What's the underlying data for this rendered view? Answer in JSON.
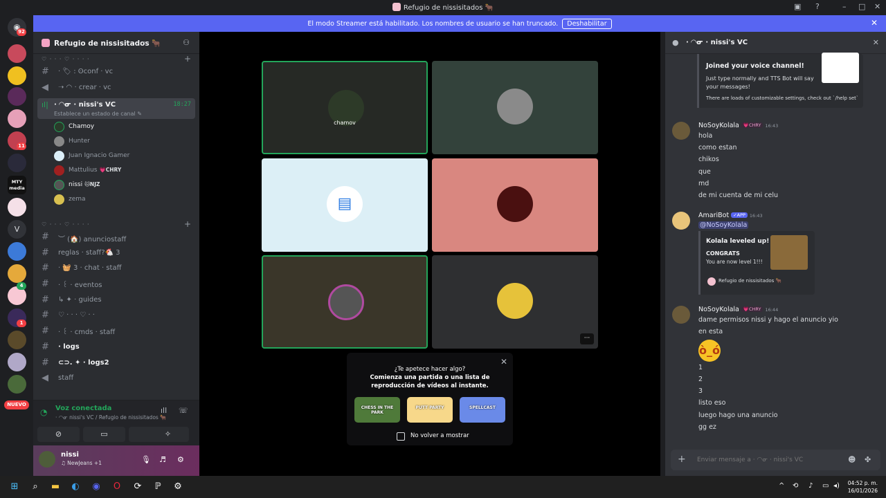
{
  "window": {
    "title": "Refugio de nissisitados 🐂"
  },
  "banner": {
    "text": "El modo Streamer está habilitado. Los nombres de usuario se han truncado.",
    "button": "Deshabilitar"
  },
  "guilds": {
    "badge_top": "92",
    "badge_a": "11",
    "badge_b": "4",
    "badge_c": "1",
    "nuevo": "NUEVO",
    "mty": "MTY media",
    "v": "V"
  },
  "server": {
    "name": "Refugio de nissisitados 🐂"
  },
  "categories": {
    "cat1": "♡ · · · ♡ · · · ·",
    "cat2": "♡ · · · ♡ · · · ·"
  },
  "channels": [
    {
      "label": "·  🏷  : ʘconf · vc"
    },
    {
      "label": "➝ ◠ · crear · vc"
    },
    {
      "label": "· ◠ᓂ · nissi's VC"
    },
    {
      "label": "︶ (🏠) anunciostaff"
    },
    {
      "label": "reglas · staff?🐔 3"
    },
    {
      "label": "· 🧺 3 · chat · staff"
    },
    {
      "label": "· ꒰ · eventos"
    },
    {
      "label": "↳ ✦ · guides"
    },
    {
      "label": "♡ · · · ♡ · ·"
    },
    {
      "label": "· ꒰ · cmds · staff"
    },
    {
      "label": "· logs"
    },
    {
      "label": "⊂⊃. ✦ · logs2"
    },
    {
      "label": "staff"
    }
  ],
  "voice_channel": {
    "name": "· ◠ᓂ · nissi's VC",
    "time": "18:27",
    "status": "Establece un estado de canal ✎"
  },
  "voice_users": [
    {
      "name": "Chamoy",
      "tag": ""
    },
    {
      "name": "Hunter",
      "tag": ""
    },
    {
      "name": "Juan Ignacio Gamer",
      "tag": ""
    },
    {
      "name": "Mattulius",
      "tag": "💗CHRY"
    },
    {
      "name": "nissi",
      "tag": "🐱NJZ"
    },
    {
      "name": "zema",
      "tag": ""
    }
  ],
  "voice_panel": {
    "status": "Voz conectada",
    "sub": "· ◠ᓂ nissi's VC / Refugio de nissisitados 🐂"
  },
  "user_panel": {
    "name": "nissi",
    "activity": "♫ NewJeans +1"
  },
  "tiles": [
    {
      "name": "chamov",
      "bg": "#262925",
      "avatar": "#2d3a28"
    },
    {
      "name": "",
      "bg": "#33423b",
      "avatar": "#8a8a8a"
    },
    {
      "name": "",
      "bg": "#dceff6",
      "avatar": "#ffffff"
    },
    {
      "name": "",
      "bg": "#d98780",
      "avatar": "#4a1010"
    },
    {
      "name": "",
      "bg": "#3a3629",
      "avatar": "#555"
    },
    {
      "name": "",
      "bg": "#2e2f31",
      "avatar": "#e6c23a"
    }
  ],
  "activity": {
    "line1": "¿Te apetece hacer algo?",
    "line2": "Comienza una partida o una lista de",
    "line3": "reproducción de vídeos al instante.",
    "card1": "CHESS IN THE PARK",
    "card2": "PUTT PARTY",
    "card3": "SPELLCAST",
    "checkbox": "No volver a mostrar"
  },
  "chat": {
    "header": "· ◠ᓂ · nissi's VC",
    "embed1": {
      "title": "Joined your voice channel!",
      "desc": "Just type normally and TTS Bot will say your messages!",
      "footer": "There are loads of customizable settings, check out `/help set`"
    },
    "msg1": {
      "user": "NoSoyKolala",
      "badge": "💗CHRY",
      "time": "16:43",
      "lines": [
        "hola",
        "como estan",
        "chikos",
        "que",
        "md",
        "de mi cuenta de mi celu"
      ]
    },
    "msg2": {
      "user": "AmariBot",
      "badge": "✓APP",
      "time": "16:43",
      "mention": "@NoSoyKolala",
      "embed_title": "Kolala leveled up!",
      "embed_sub": "CONGRATS",
      "embed_desc": "You are now level 1!!!",
      "embed_footer": "Refugio de nissisitados 🐂"
    },
    "msg3": {
      "user": "NoSoyKolala",
      "badge": "💗CHRY",
      "time": "16:44",
      "lines": [
        "dame permisos nissi y hago el anuncio yio",
        "en esta"
      ],
      "lines2": [
        "1",
        "2",
        "3",
        "listo eso",
        "luego hago una anuncio",
        "gg ez"
      ]
    },
    "input_placeholder": "Enviar mensaje a · ◠ᓂ · nissi's VC"
  },
  "taskbar": {
    "time": "04:52 p. m.",
    "date": "16/01/2026"
  }
}
